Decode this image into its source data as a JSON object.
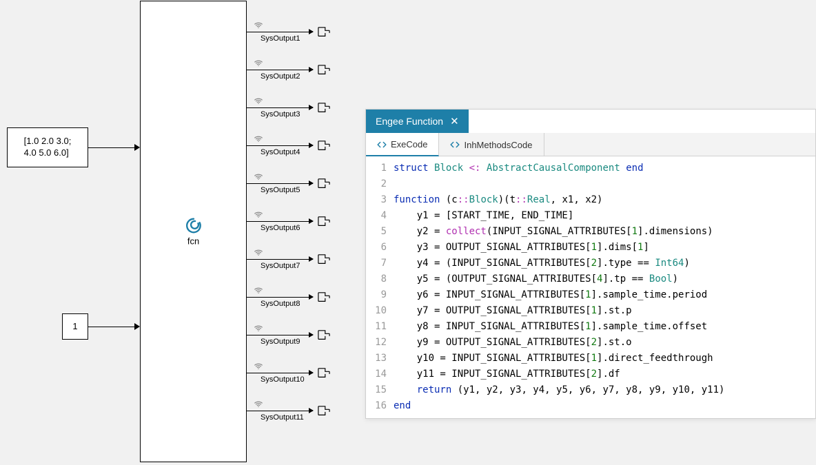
{
  "diagram": {
    "const1": "[1.0 2.0 3.0;\n4.0 5.0 6.0]",
    "const2": "1",
    "fcn_label": "fcn",
    "outputs": [
      "SysOutput1",
      "SysOutput2",
      "SysOutput3",
      "SysOutput4",
      "SysOutput5",
      "SysOutput6",
      "SysOutput7",
      "SysOutput8",
      "SysOutput9",
      "SysOutput10",
      "SysOutput11"
    ]
  },
  "editor": {
    "title": "Engee Function",
    "tabs": {
      "active": "ExeCode",
      "inactive": "InhMethodsCode"
    },
    "code_lines": [
      [
        [
          "kw",
          "struct"
        ],
        [
          "",
          " "
        ],
        [
          "type",
          "Block"
        ],
        [
          "",
          " "
        ],
        [
          "op",
          "<:"
        ],
        [
          "",
          " "
        ],
        [
          "type",
          "AbstractCausalComponent"
        ],
        [
          "",
          " "
        ],
        [
          "kw",
          "end"
        ]
      ],
      [],
      [
        [
          "kw",
          "function"
        ],
        [
          "",
          " (c"
        ],
        [
          "op",
          "::"
        ],
        [
          "type",
          "Block"
        ],
        [
          "",
          ")(t"
        ],
        [
          "op",
          "::"
        ],
        [
          "type",
          "Real"
        ],
        [
          "",
          ", x1, x2)"
        ]
      ],
      [
        [
          "",
          "    y1 = [START_TIME, END_TIME]"
        ]
      ],
      [
        [
          "",
          "    y2 = "
        ],
        [
          "fn",
          "collect"
        ],
        [
          "",
          "(INPUT_SIGNAL_ATTRIBUTES["
        ],
        [
          "num",
          "1"
        ],
        [
          "",
          "].dimensions)"
        ]
      ],
      [
        [
          "",
          "    y3 = OUTPUT_SIGNAL_ATTRIBUTES["
        ],
        [
          "num",
          "1"
        ],
        [
          "",
          "].dims["
        ],
        [
          "num",
          "1"
        ],
        [
          "",
          "]"
        ]
      ],
      [
        [
          "",
          "    y4 = (INPUT_SIGNAL_ATTRIBUTES["
        ],
        [
          "num",
          "2"
        ],
        [
          "",
          "].type == "
        ],
        [
          "type",
          "Int64"
        ],
        [
          "",
          ")"
        ]
      ],
      [
        [
          "",
          "    y5 = (OUTPUT_SIGNAL_ATTRIBUTES["
        ],
        [
          "num",
          "4"
        ],
        [
          "",
          "].tp == "
        ],
        [
          "type",
          "Bool"
        ],
        [
          "",
          ")"
        ]
      ],
      [
        [
          "",
          "    y6 = INPUT_SIGNAL_ATTRIBUTES["
        ],
        [
          "num",
          "1"
        ],
        [
          "",
          "].sample_time.period"
        ]
      ],
      [
        [
          "",
          "    y7 = OUTPUT_SIGNAL_ATTRIBUTES["
        ],
        [
          "num",
          "1"
        ],
        [
          "",
          "].st.p"
        ]
      ],
      [
        [
          "",
          "    y8 = INPUT_SIGNAL_ATTRIBUTES["
        ],
        [
          "num",
          "1"
        ],
        [
          "",
          "].sample_time.offset"
        ]
      ],
      [
        [
          "",
          "    y9 = OUTPUT_SIGNAL_ATTRIBUTES["
        ],
        [
          "num",
          "2"
        ],
        [
          "",
          "].st.o"
        ]
      ],
      [
        [
          "",
          "    y10 = INPUT_SIGNAL_ATTRIBUTES["
        ],
        [
          "num",
          "1"
        ],
        [
          "",
          "].direct_feedthrough"
        ]
      ],
      [
        [
          "",
          "    y11 = INPUT_SIGNAL_ATTRIBUTES["
        ],
        [
          "num",
          "2"
        ],
        [
          "",
          "].df"
        ]
      ],
      [
        [
          "",
          "    "
        ],
        [
          "kw",
          "return"
        ],
        [
          "",
          " (y1, y2, y3, y4, y5, y6, y7, y8, y9, y10, y11)"
        ]
      ],
      [
        [
          "kw",
          "end"
        ]
      ]
    ]
  }
}
